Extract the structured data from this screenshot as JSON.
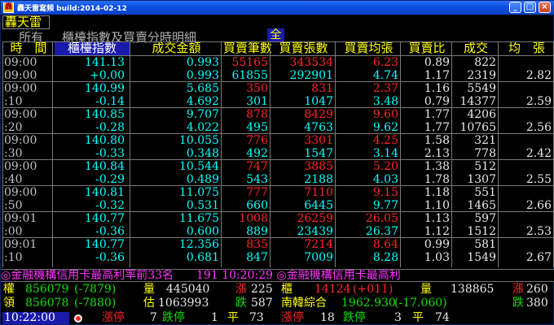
{
  "window": {
    "title": "轟天雷寫頻 build:2014-02-12",
    "icon_glyph": "轟"
  },
  "logo": "轟天雷",
  "subheader": {
    "left_label": "所有",
    "right_label": "櫃檯指數及買賣分時明細",
    "all_button": "全"
  },
  "columns": [
    "時　間",
    "櫃檯指數",
    "成交金額",
    "買賣筆數",
    "買賣張數",
    "買賣均張",
    "買賣比",
    "成交",
    "均　張"
  ],
  "rows": [
    {
      "time": [
        "09:00",
        "09:00"
      ],
      "idx": [
        "141.13",
        "+0.00"
      ],
      "amt": [
        "0.993",
        "0.993"
      ],
      "cnt": [
        "55165",
        "61855"
      ],
      "vol": [
        "343534",
        "292901"
      ],
      "avg": [
        "6.23",
        "4.74"
      ],
      "ratio": [
        "0.89",
        "1.17"
      ],
      "deal": [
        "822",
        "2319"
      ],
      "avgdeal": "2.82"
    },
    {
      "time": [
        "09:00",
        ":10"
      ],
      "idx": [
        "140.99",
        "-0.14"
      ],
      "amt": [
        "5.685",
        "4.692"
      ],
      "cnt": [
        "350",
        "301"
      ],
      "vol": [
        "831",
        "1047"
      ],
      "avg": [
        "2.37",
        "3.48"
      ],
      "ratio": [
        "1.16",
        "0.79"
      ],
      "deal": [
        "5549",
        "14377"
      ],
      "avgdeal": "2.59"
    },
    {
      "time": [
        "09:00",
        ":20"
      ],
      "idx": [
        "140.85",
        "-0.28"
      ],
      "amt": [
        "9.707",
        "4.022"
      ],
      "cnt": [
        "878",
        "495"
      ],
      "vol": [
        "8429",
        "4763"
      ],
      "avg": [
        "9.60",
        "9.62"
      ],
      "ratio": [
        "1.77",
        "1.77"
      ],
      "deal": [
        "4206",
        "10765"
      ],
      "avgdeal": "2.56"
    },
    {
      "time": [
        "09:00",
        ":30"
      ],
      "idx": [
        "140.80",
        "-0.33"
      ],
      "amt": [
        "10.055",
        "0.348"
      ],
      "cnt": [
        "776",
        "492"
      ],
      "vol": [
        "3301",
        "1547"
      ],
      "avg": [
        "4.25",
        "3.14"
      ],
      "ratio": [
        "1.58",
        "2.13"
      ],
      "deal": [
        "321",
        "778"
      ],
      "avgdeal": "2.42"
    },
    {
      "time": [
        "09:00",
        ":40"
      ],
      "idx": [
        "140.84",
        "-0.29"
      ],
      "amt": [
        "10.544",
        "0.489"
      ],
      "cnt": [
        "747",
        "543"
      ],
      "vol": [
        "3885",
        "2188"
      ],
      "avg": [
        "5.20",
        "4.03"
      ],
      "ratio": [
        "1.38",
        "1.78"
      ],
      "deal": [
        "512",
        "1307"
      ],
      "avgdeal": "2.55"
    },
    {
      "time": [
        "09:00",
        ":50"
      ],
      "idx": [
        "140.81",
        "-0.32"
      ],
      "amt": [
        "11.075",
        "0.531"
      ],
      "cnt": [
        "777",
        "660"
      ],
      "vol": [
        "7110",
        "6445"
      ],
      "avg": [
        "9.15",
        "9.77"
      ],
      "ratio": [
        "1.18",
        "1.10"
      ],
      "deal": [
        "551",
        "1465"
      ],
      "avgdeal": "2.66"
    },
    {
      "time": [
        "09:01",
        ":00"
      ],
      "idx": [
        "140.77",
        "-0.36"
      ],
      "amt": [
        "11.675",
        "0.600"
      ],
      "cnt": [
        "1008",
        "889"
      ],
      "vol": [
        "26259",
        "23439"
      ],
      "avg": [
        "26.05",
        "26.37"
      ],
      "ratio": [
        "1.13",
        "1.12"
      ],
      "deal": [
        "597",
        "1512"
      ],
      "avgdeal": "2.53"
    },
    {
      "time": [
        "09:01",
        ":10"
      ],
      "idx": [
        "140.77",
        "-0.36"
      ],
      "amt": [
        "12.356",
        "0.681"
      ],
      "cnt": [
        "835",
        "847"
      ],
      "vol": [
        "7214",
        "7009"
      ],
      "avg": [
        "8.64",
        "8.28"
      ],
      "ratio": [
        "0.99",
        "1.03"
      ],
      "deal": [
        "581",
        "1549"
      ],
      "avgdeal": "2.67"
    }
  ],
  "ticker": "◎金融機構信用卡最高利率前33名　　191 10:20:29 ◎金融機構信用卡最高利",
  "bottom": {
    "r1": {
      "l1": "權",
      "l1v": "856079",
      "l1c": "(-7879)",
      "vol_label": "量",
      "vol": "445040",
      "up_label": "漲",
      "up": "225",
      "l2": "櫃",
      "l2v": "14124",
      "l2c": "(+011)",
      "vol2_label": "量",
      "vol2": "138865",
      "up2_label": "漲",
      "up2": "260"
    },
    "r2": {
      "l1": "領",
      "l1v": "856078",
      "l1c": "(-7880)",
      "est_label": "估",
      "est": "1063993",
      "down_label": "跌",
      "down": "587",
      "l2": "南韓綜合",
      "l2v": "1962.930",
      "l2c": "(-17.060)",
      "down2_label": "跌",
      "down2": "380"
    },
    "r3": {
      "time": "10:22:00",
      "lu_label": "漲停",
      "lu": "7",
      "ld_label": "跌停",
      "ld": "1",
      "flat_label": "平",
      "flat": "73",
      "lu2_label": "漲停",
      "lu2": "18",
      "ld2_label": "跌停",
      "ld2": "3",
      "flat2_label": "平",
      "flat2": "74"
    }
  },
  "colors": {
    "up": "#ff2424",
    "down": "#10e000",
    "index": "#00ffff",
    "accent": "#ffff00"
  }
}
